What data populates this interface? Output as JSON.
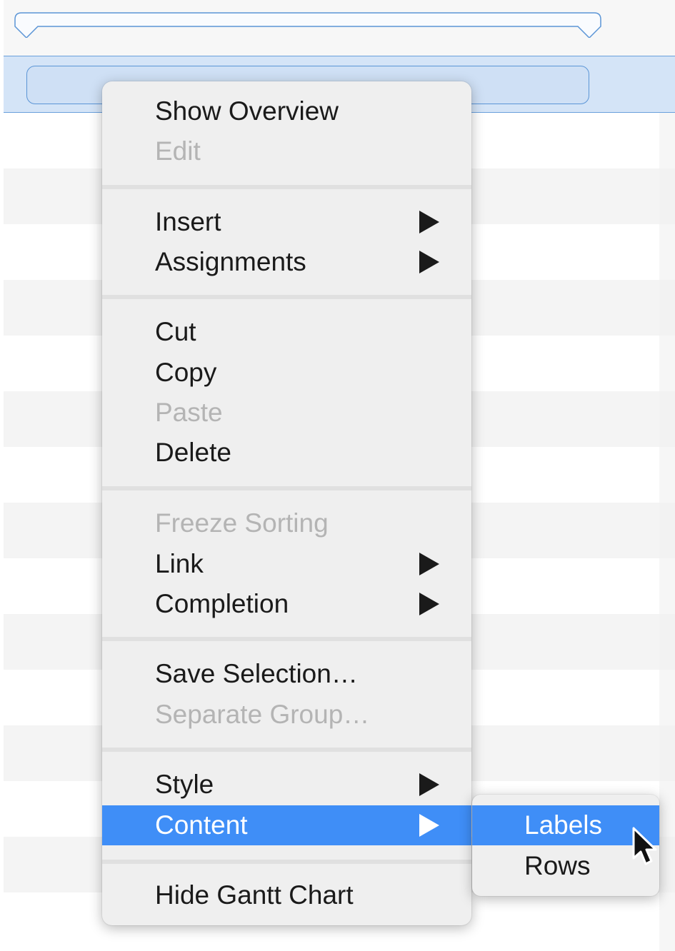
{
  "menu": {
    "items": [
      {
        "label": "Show Overview",
        "enabled": true,
        "submenu": false
      },
      {
        "label": "Edit",
        "enabled": false,
        "submenu": false
      },
      {
        "label": "Insert",
        "enabled": true,
        "submenu": true
      },
      {
        "label": "Assignments",
        "enabled": true,
        "submenu": true
      },
      {
        "label": "Cut",
        "enabled": true,
        "submenu": false
      },
      {
        "label": "Copy",
        "enabled": true,
        "submenu": false
      },
      {
        "label": "Paste",
        "enabled": false,
        "submenu": false
      },
      {
        "label": "Delete",
        "enabled": true,
        "submenu": false
      },
      {
        "label": "Freeze Sorting",
        "enabled": false,
        "submenu": false
      },
      {
        "label": "Link",
        "enabled": true,
        "submenu": true
      },
      {
        "label": "Completion",
        "enabled": true,
        "submenu": true
      },
      {
        "label": "Save Selection…",
        "enabled": true,
        "submenu": false
      },
      {
        "label": "Separate Group…",
        "enabled": false,
        "submenu": false
      },
      {
        "label": "Style",
        "enabled": true,
        "submenu": true
      },
      {
        "label": "Content",
        "enabled": true,
        "submenu": true,
        "highlighted": true
      },
      {
        "label": "Hide Gantt Chart",
        "enabled": true,
        "submenu": false
      }
    ]
  },
  "submenu": {
    "items": [
      {
        "label": "Labels",
        "highlighted": true
      },
      {
        "label": "Rows",
        "highlighted": false
      }
    ]
  },
  "icons": {
    "submenu_arrow": "triangle-right-icon",
    "cursor": "arrow-pointer-icon"
  },
  "colors": {
    "highlight": "#3f8ef7",
    "selected_row": "#d4e4f7",
    "bar_border": "#5b95d6",
    "disabled_text": "#b4b4b4"
  }
}
